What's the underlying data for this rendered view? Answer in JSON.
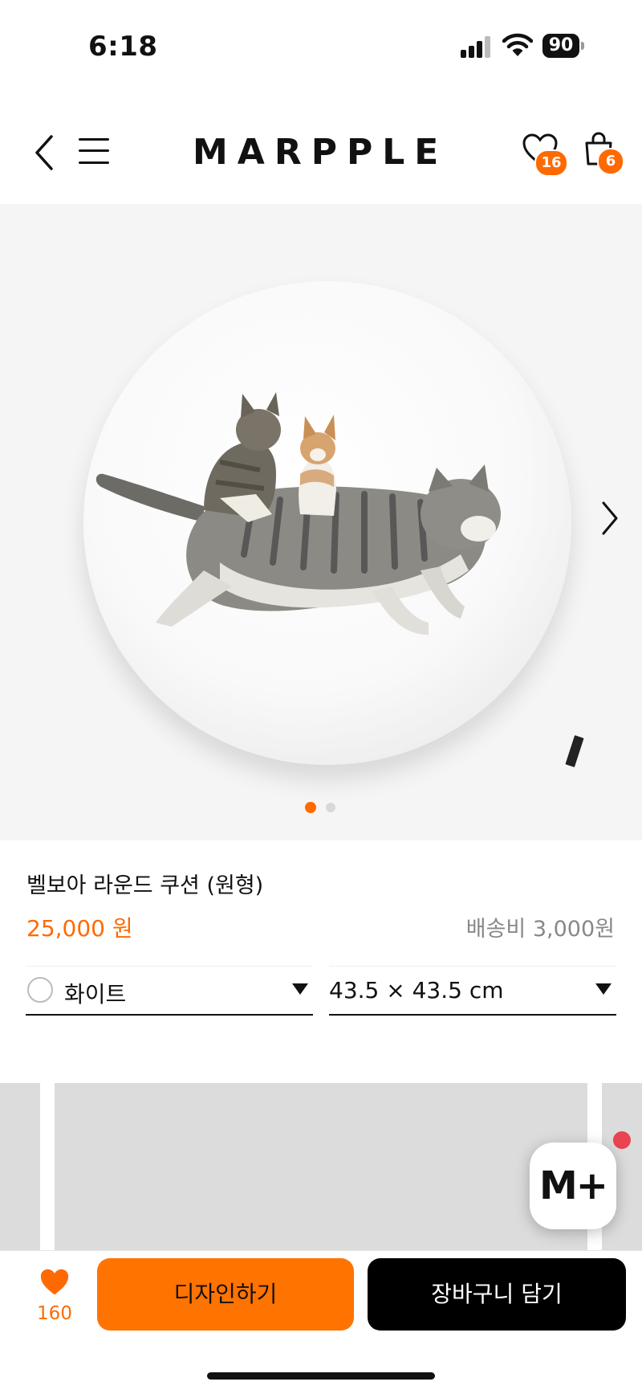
{
  "status_bar": {
    "time": "6:18",
    "battery": "90"
  },
  "header": {
    "logo": "MARPPLE",
    "wishlist_count": "16",
    "cart_count": "6"
  },
  "gallery": {
    "image_count": 2,
    "active_index": 0
  },
  "product": {
    "name": "벨보아 라운드 쿠션 (원형)",
    "price": "25,000 원",
    "shipping": "배송비 3,000원"
  },
  "options": {
    "color_value": "화이트",
    "size_value": "43.5 × 43.5 cm"
  },
  "floating": {
    "mplus_label": "M+"
  },
  "bottom_bar": {
    "like_count": "160",
    "design_label": "디자인하기",
    "cart_label": "장바구니 담기"
  },
  "colors": {
    "accent": "#ff6a00",
    "primary_button": "#ff7300",
    "secondary_button": "#000000",
    "notification_dot": "#e9444f"
  }
}
